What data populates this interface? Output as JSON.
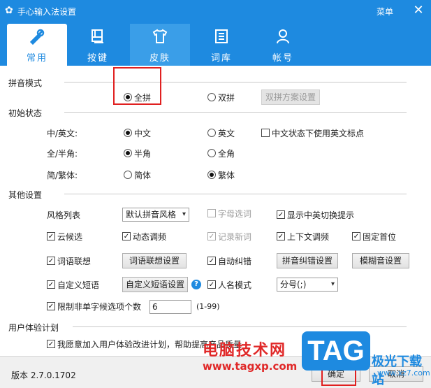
{
  "window": {
    "title": "手心输入法设置",
    "menu_label": "菜单",
    "close_glyph": "✕"
  },
  "tabs": [
    {
      "label": "常用",
      "icon": "wrench-icon",
      "active": true
    },
    {
      "label": "按键",
      "icon": "keyboard-icon"
    },
    {
      "label": "皮肤",
      "icon": "shirt-icon"
    },
    {
      "label": "词库",
      "icon": "book-icon"
    },
    {
      "label": "帐号",
      "icon": "user-icon"
    }
  ],
  "pinyin_mode": {
    "section": "拼音模式",
    "full": "全拼",
    "double": "双拼",
    "double_settings_button": "双拼方案设置"
  },
  "initial_state": {
    "section": "初始状态",
    "cn_en_label": "中/英文:",
    "cn": "中文",
    "en": "英文",
    "cn_use_en_punct": "中文状态下使用英文标点",
    "width_label": "全/半角:",
    "half": "半角",
    "full": "全角",
    "script_label": "简/繁体:",
    "simplified": "简体",
    "traditional": "繁体"
  },
  "other": {
    "section": "其他设置",
    "style_label": "风格列表",
    "style_value": "默认拼音风格",
    "letter_select": "字母选词",
    "show_switch_tip": "显示中英切换提示",
    "cloud_candidates": "云候选",
    "dynamic_freq": "动态调频",
    "record_new_words": "记录新词",
    "context_freq": "上下文调频",
    "fixed_first": "固定首位",
    "word_association": "词语联想",
    "word_association_button": "词语联想设置",
    "auto_correct": "自动纠错",
    "pinyin_correct_button": "拼音纠错设置",
    "fuzzy_button": "模糊音设置",
    "custom_phrase": "自定义短语",
    "custom_phrase_button": "自定义短语设置",
    "help_glyph": "?",
    "name_mode": "人名模式",
    "separator_value": "分号(;)",
    "limit_label": "限制非单字候选项个数",
    "limit_value": "6",
    "limit_range": "(1-99)"
  },
  "ux": {
    "section": "用户体验计划",
    "join": "我愿意加入用户体验改进计划，帮助提高产品质量"
  },
  "footer": {
    "version": "版本 2.7.0.1702",
    "ok": "确定",
    "cancel": "取消"
  },
  "watermark": {
    "site_cn": "电脑技术网",
    "site_url": "www.tagxp.com",
    "tag": "TAG",
    "dl": "极光下载站",
    "dl_url": "www.xz7.com"
  },
  "colors": {
    "accent": "#1e8ae0",
    "highlight": "#e02020"
  }
}
